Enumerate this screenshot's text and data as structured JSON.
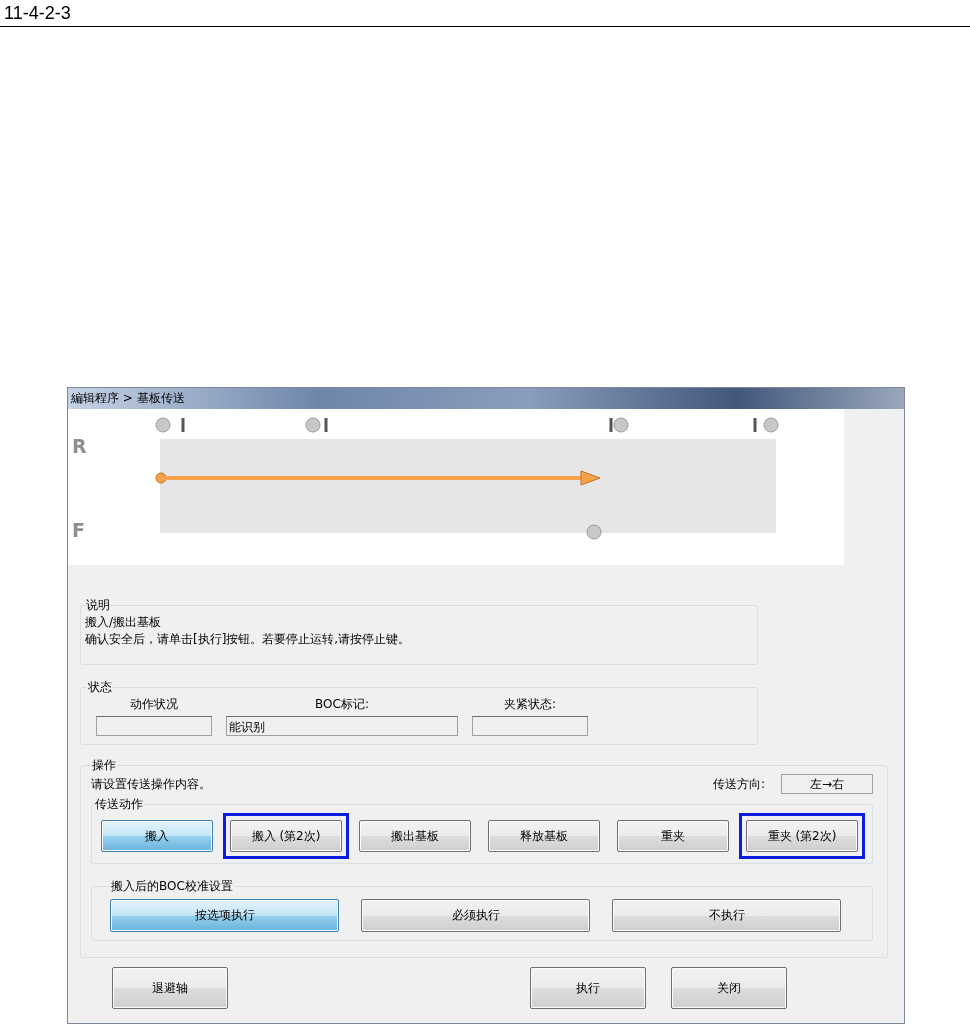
{
  "page_header": {
    "section": "11-4-2-3"
  },
  "window": {
    "title": "編辑程序 > 基板传送"
  },
  "diagram": {
    "row_labels": [
      "R",
      "F"
    ]
  },
  "description": {
    "title": "说明",
    "lines": [
      "搬入/搬出基板",
      "确认安全后，请单击[执行]按钮。若要停止运转,请按停止键。"
    ]
  },
  "status": {
    "title": "状态",
    "fields": [
      {
        "label": "动作状况"
      },
      {
        "label": "BOC标记:",
        "value": "能识别"
      },
      {
        "label": "夹紧状态:"
      }
    ]
  },
  "operation": {
    "title": "操作",
    "hint": "请设置传送操作内容。",
    "direction_label": "传送方向:",
    "direction_value": "左→右",
    "transfer": {
      "title": "传送动作",
      "buttons": [
        {
          "label": "搬入",
          "selected": true,
          "highlighted": false
        },
        {
          "label": "搬入 (第2次)",
          "selected": false,
          "highlighted": true
        },
        {
          "label": "搬出基板",
          "selected": false,
          "highlighted": false
        },
        {
          "label": "释放基板",
          "selected": false,
          "highlighted": false
        },
        {
          "label": "重夹",
          "selected": false,
          "highlighted": false
        },
        {
          "label": "重夹 (第2次)",
          "selected": false,
          "highlighted": true
        }
      ]
    },
    "boc": {
      "title": "搬入后的BOC校准设置",
      "buttons": [
        {
          "label": "按选项执行",
          "selected": true
        },
        {
          "label": "必须执行",
          "selected": false
        },
        {
          "label": "不执行",
          "selected": false
        }
      ]
    }
  },
  "footer_buttons": [
    {
      "label": "退避轴"
    },
    {
      "label": "执行"
    },
    {
      "label": "关闭"
    }
  ]
}
